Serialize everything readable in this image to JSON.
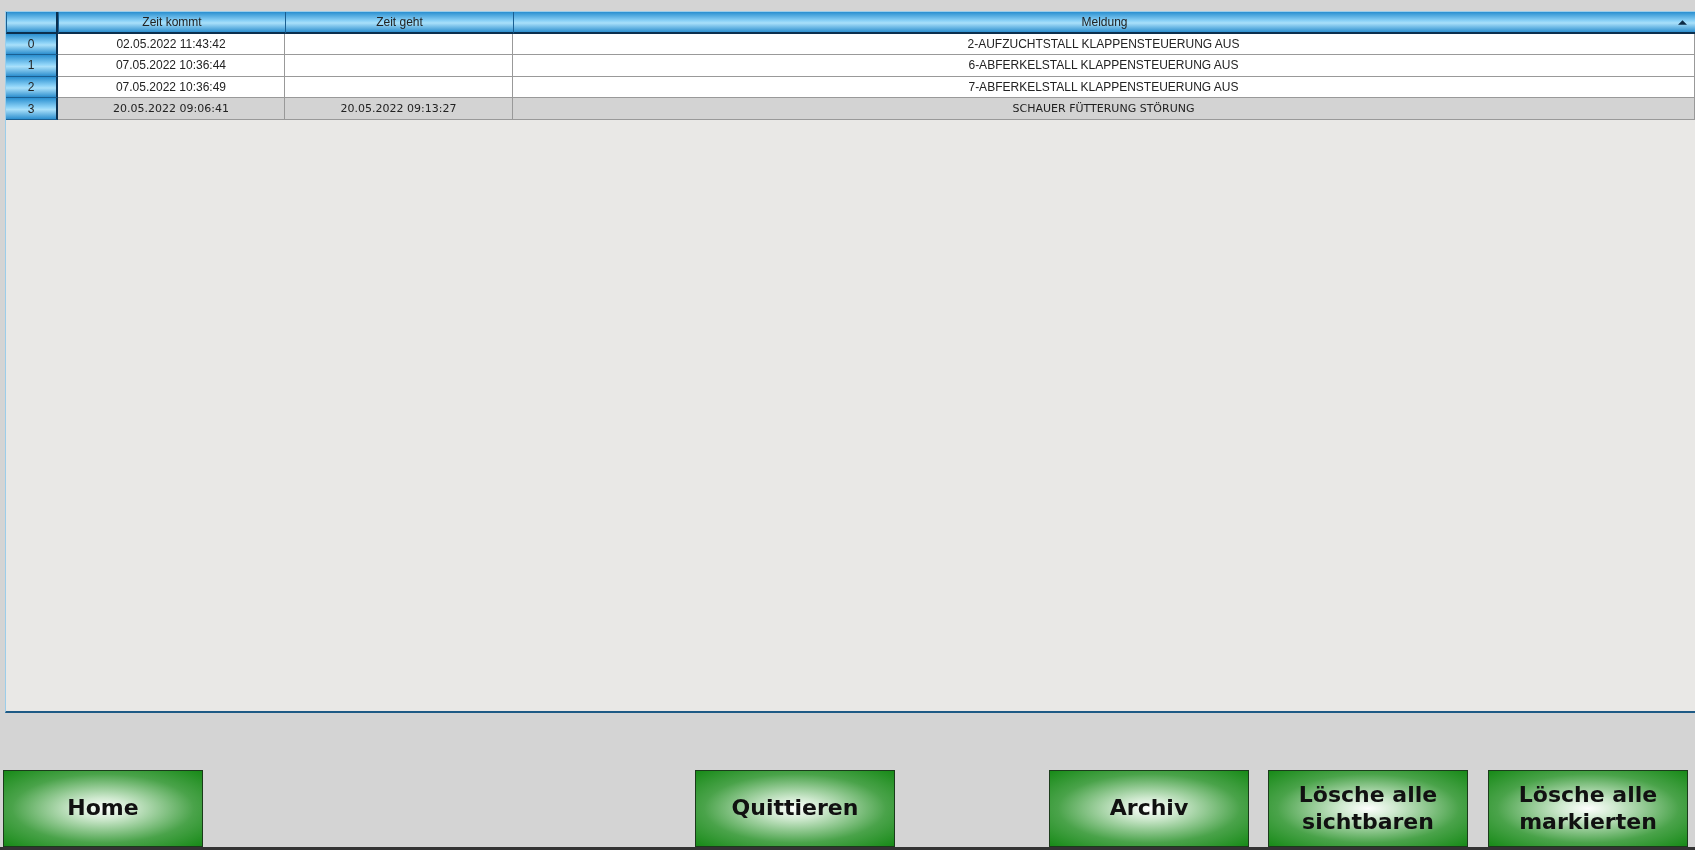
{
  "table": {
    "columns": [
      {
        "sort_ascending": false
      },
      {
        "label": "Zeit kommt",
        "sort_ascending": false
      },
      {
        "label": "Zeit geht",
        "sort_ascending": false
      },
      {
        "label": "Meldung",
        "sort_ascending": true
      }
    ],
    "rows": [
      {
        "index": "0",
        "came": "02.05.2022 11:43:42",
        "went": "",
        "message": "2-AUFZUCHTSTALL KLAPPENSTEUERUNG AUS",
        "cleared": false
      },
      {
        "index": "1",
        "came": "07.05.2022 10:36:44",
        "went": "",
        "message": "6-ABFERKELSTALL KLAPPENSTEUERUNG AUS",
        "cleared": false
      },
      {
        "index": "2",
        "came": "07.05.2022 10:36:49",
        "went": "",
        "message": "7-ABFERKELSTALL KLAPPENSTEUERUNG AUS",
        "cleared": false
      },
      {
        "index": "3",
        "came": "20.05.2022 09:06:41",
        "went": "20.05.2022 09:13:27",
        "message": "SCHAUER FÜTTERUNG STÖRUNG",
        "cleared": true
      }
    ]
  },
  "buttons": [
    {
      "label": "Home"
    },
    {
      "label": "Quittieren"
    },
    {
      "label": "Archiv"
    },
    {
      "label": "Lösche alle sichtbaren"
    },
    {
      "label": "Lösche alle markierten"
    }
  ]
}
